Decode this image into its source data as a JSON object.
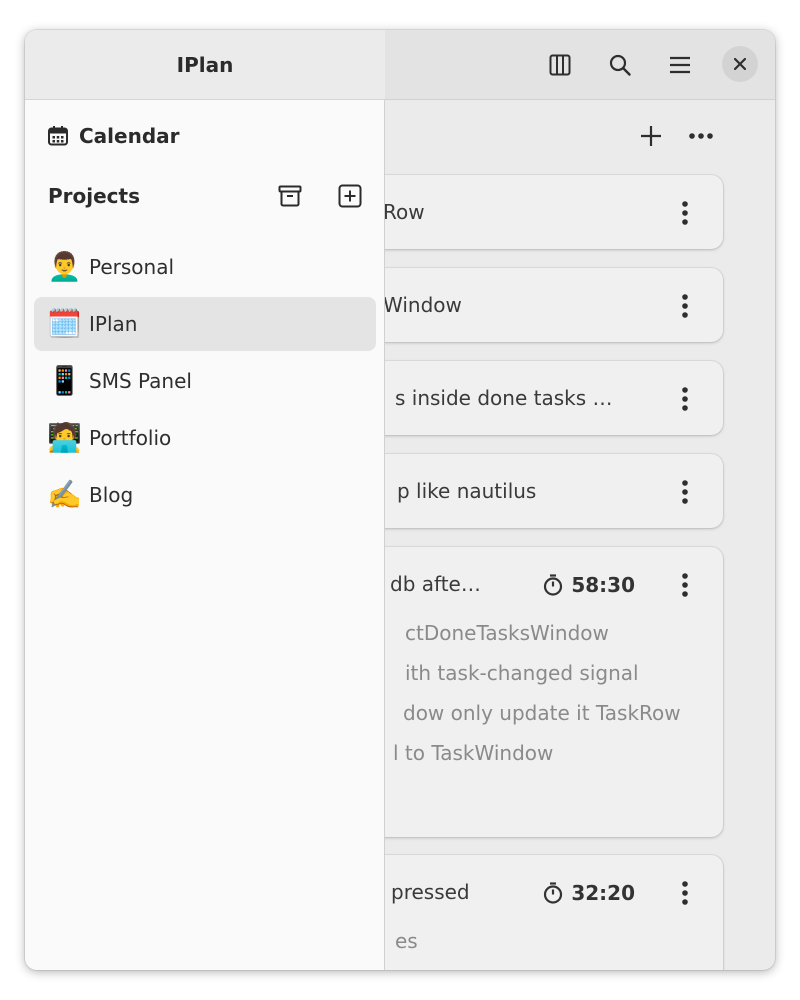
{
  "sidebar": {
    "title": "IPlan",
    "calendar_label": "Calendar",
    "projects_label": "Projects",
    "projects": [
      {
        "emoji": "👨‍🦱",
        "label": "Personal",
        "selected": false
      },
      {
        "emoji": "🗓️",
        "label": "IPlan",
        "selected": true
      },
      {
        "emoji": "📱",
        "label": "SMS Panel",
        "selected": false
      },
      {
        "emoji": "🧑‍💻",
        "label": "Portfolio",
        "selected": false
      },
      {
        "emoji": "✍️",
        "label": "Blog",
        "selected": false
      }
    ]
  },
  "tasks": [
    {
      "title": "Row"
    },
    {
      "title": "Window"
    },
    {
      "title": "s inside done tasks …"
    },
    {
      "title": "p like nautilus"
    },
    {
      "title": "db afte…",
      "timer": "58:30",
      "subtasks": [
        "ctDoneTasksWindow",
        "ith task-changed signal",
        "dow only update it TaskRow",
        "l to TaskWindow"
      ]
    },
    {
      "title": "pressed",
      "timer": "32:20",
      "subtasks": [
        "es"
      ]
    }
  ],
  "colors": {
    "sidebar_bg": "#fafafa",
    "selected_bg": "#e4e4e4",
    "header_bg": "#ebebeb",
    "card_bg": "#f0f0f0"
  }
}
